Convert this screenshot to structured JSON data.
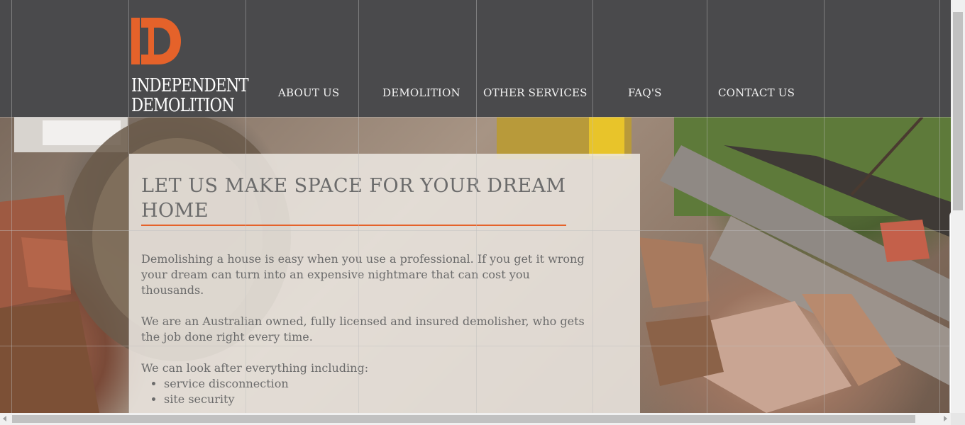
{
  "brand": {
    "name_line1": "INDEPENDENT",
    "name_line2": "DEMOLITION",
    "accent_color": "#e5622a",
    "header_bg": "#4a4a4c"
  },
  "nav": {
    "items": [
      {
        "label": "ABOUT US"
      },
      {
        "label": "DEMOLITION"
      },
      {
        "label": "OTHER SERVICES"
      },
      {
        "label": "FAQ'S"
      },
      {
        "label": "CONTACT US"
      }
    ]
  },
  "hero": {
    "title": "LET US MAKE SPACE FOR YOUR DREAM HOME",
    "paragraph1": "Demolishing a house is easy when you use a professional. If you get it wrong your dream can turn into an expensive nightmare that can cost you thousands.",
    "paragraph2": "We are an Australian owned, fully licensed and insured demolisher, who gets the job done right every time.",
    "list_intro": "We can look after everything including:",
    "list_items": [
      "service disconnection",
      "site security"
    ]
  },
  "side_tab": {
    "icon": "chevron-left-icon",
    "arrow_color": "#2f8fd8"
  }
}
